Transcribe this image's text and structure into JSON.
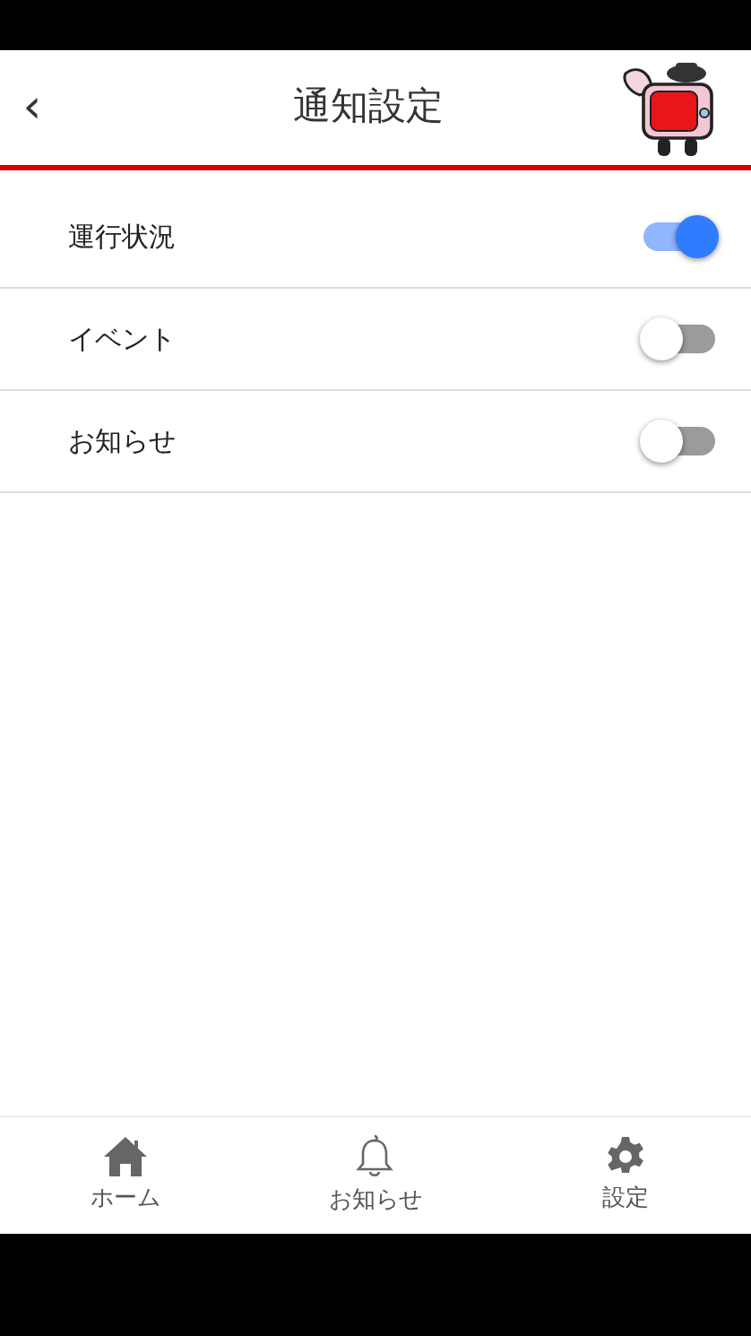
{
  "header": {
    "back": "‹",
    "title": "通知設定"
  },
  "settings": [
    {
      "label": "運行状況",
      "on": true
    },
    {
      "label": "イベント",
      "on": false
    },
    {
      "label": "お知らせ",
      "on": false
    }
  ],
  "bottom_nav": [
    {
      "kind": "home",
      "label": "ホーム"
    },
    {
      "kind": "bell",
      "label": "お知らせ"
    },
    {
      "kind": "gear",
      "label": "設定"
    }
  ]
}
